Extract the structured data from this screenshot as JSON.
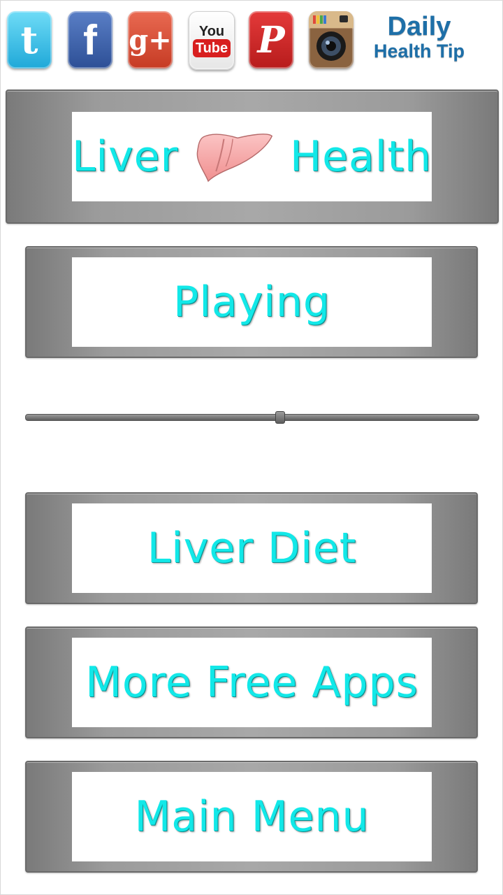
{
  "social": {
    "twitter_glyph": "t",
    "facebook_glyph": "f",
    "googleplus_glyph": "g+",
    "youtube_top": "You",
    "youtube_bottom": "Tube",
    "pinterest_glyph": "P"
  },
  "daily_tip": {
    "line1": "Daily",
    "line2": "Health Tip"
  },
  "header": {
    "left": "Liver",
    "right": "Health"
  },
  "player": {
    "status": "Playing",
    "progress": 0.56
  },
  "menu": {
    "liver_diet": "Liver Diet",
    "more_apps": "More Free Apps",
    "main_menu": "Main Menu"
  },
  "colors": {
    "label_text": "#12e8e8",
    "panel": "#9b9b9b",
    "liver": "#f5a8a8"
  }
}
